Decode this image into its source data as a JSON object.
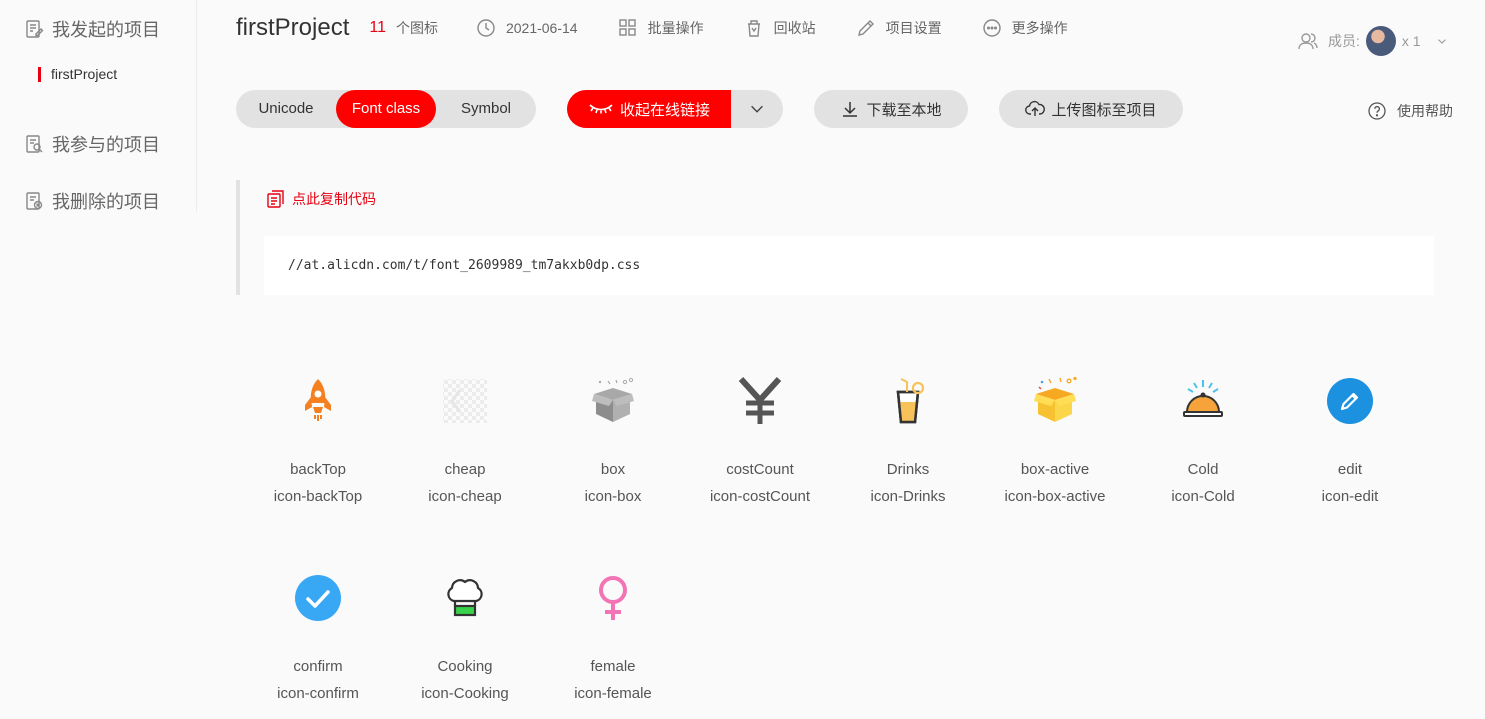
{
  "sidebar": {
    "items": [
      {
        "label": "我发起的项目",
        "icon": "edit-doc-icon"
      },
      {
        "label": "我参与的项目",
        "icon": "search-doc-icon"
      },
      {
        "label": "我删除的项目",
        "icon": "delete-doc-icon"
      }
    ],
    "sub_item": "firstProject"
  },
  "header": {
    "title": "firstProject",
    "icon_count": "11",
    "icon_count_label": "个图标",
    "date": "2021-06-14",
    "batch": "批量操作",
    "recycle": "回收站",
    "settings": "项目设置",
    "more": "更多操作",
    "members_label": "成员:",
    "members_count": "x 1"
  },
  "toolbar": {
    "tabs": [
      "Unicode",
      "Font class",
      "Symbol"
    ],
    "active_tab": "Font class",
    "collapse_label": "收起在线链接",
    "download_label": "下载至本地",
    "upload_label": "上传图标至项目",
    "help_label": "使用帮助"
  },
  "code": {
    "copy_label": "点此复制代码",
    "url": "//at.alicdn.com/t/font_2609989_tm7akxb0dp.css"
  },
  "icons": [
    {
      "name": "backTop",
      "class": "icon-backTop"
    },
    {
      "name": "cheap",
      "class": "icon-cheap"
    },
    {
      "name": "box",
      "class": "icon-box"
    },
    {
      "name": "costCount",
      "class": "icon-costCount"
    },
    {
      "name": "Drinks",
      "class": "icon-Drinks"
    },
    {
      "name": "box-active",
      "class": "icon-box-active"
    },
    {
      "name": "Cold",
      "class": "icon-Cold"
    },
    {
      "name": "edit",
      "class": "icon-edit"
    },
    {
      "name": "confirm",
      "class": "icon-confirm"
    },
    {
      "name": "Cooking",
      "class": "icon-Cooking"
    },
    {
      "name": "female",
      "class": "icon-female"
    }
  ],
  "colors": {
    "accent": "#ff0000",
    "brand_red": "#e60012",
    "pill_bg": "#e2e2e2"
  }
}
